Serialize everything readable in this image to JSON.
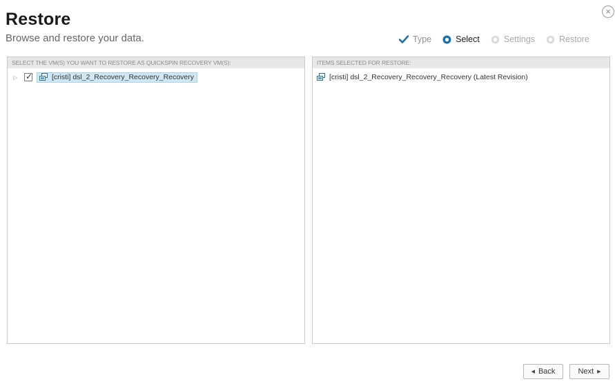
{
  "header": {
    "title": "Restore",
    "subtitle": "Browse and restore your data.",
    "close_icon": "×"
  },
  "wizard_steps": [
    {
      "label": "Type",
      "state": "done",
      "icon": "check-icon"
    },
    {
      "label": "Select",
      "state": "active",
      "icon": "circle-filled-icon"
    },
    {
      "label": "Settings",
      "state": "pending",
      "icon": "circle-empty-icon"
    },
    {
      "label": "Restore",
      "state": "pending",
      "icon": "circle-empty-icon"
    }
  ],
  "left_panel": {
    "header": "SELECT THE VM(S) YOU WANT TO RESTORE AS QUICKSPIN RECOVERY VM(S):",
    "items": [
      {
        "label": "[cristi] dsl_2_Recovery_Recovery_Recovery",
        "checked": true,
        "expand_glyph": "▷",
        "check_glyph": "✓"
      }
    ]
  },
  "right_panel": {
    "header": "ITEMS SELECTED FOR RESTORE:",
    "items": [
      {
        "label": "[cristi] dsl_2_Recovery_Recovery_Recovery (Latest Revision)"
      }
    ]
  },
  "footer": {
    "back_label": "Back",
    "next_label": "Next",
    "back_glyph": "◀",
    "next_glyph": "▶"
  },
  "colors": {
    "accent": "#1e6fb0",
    "selection_bg": "#cfe8f3",
    "panel_header_bg": "#e8e8e8"
  }
}
